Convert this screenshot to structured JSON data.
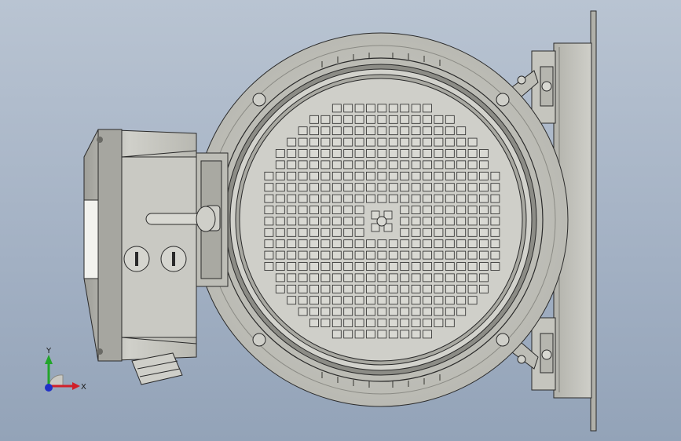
{
  "viewport": {
    "background_top": "#b9c4d2",
    "background_bottom": "#93a3b8"
  },
  "model": {
    "body_color": "#c8c8c1",
    "shadow_color": "#8e8e88",
    "edge_color": "#2a2a2a",
    "vent_hole_count_label": "",
    "shading": "shaded-with-edges"
  },
  "triad": {
    "x_label": "X",
    "y_label": "Y",
    "x_color": "#d0202a",
    "y_color": "#22a52a",
    "z_color": "#2030c8"
  }
}
